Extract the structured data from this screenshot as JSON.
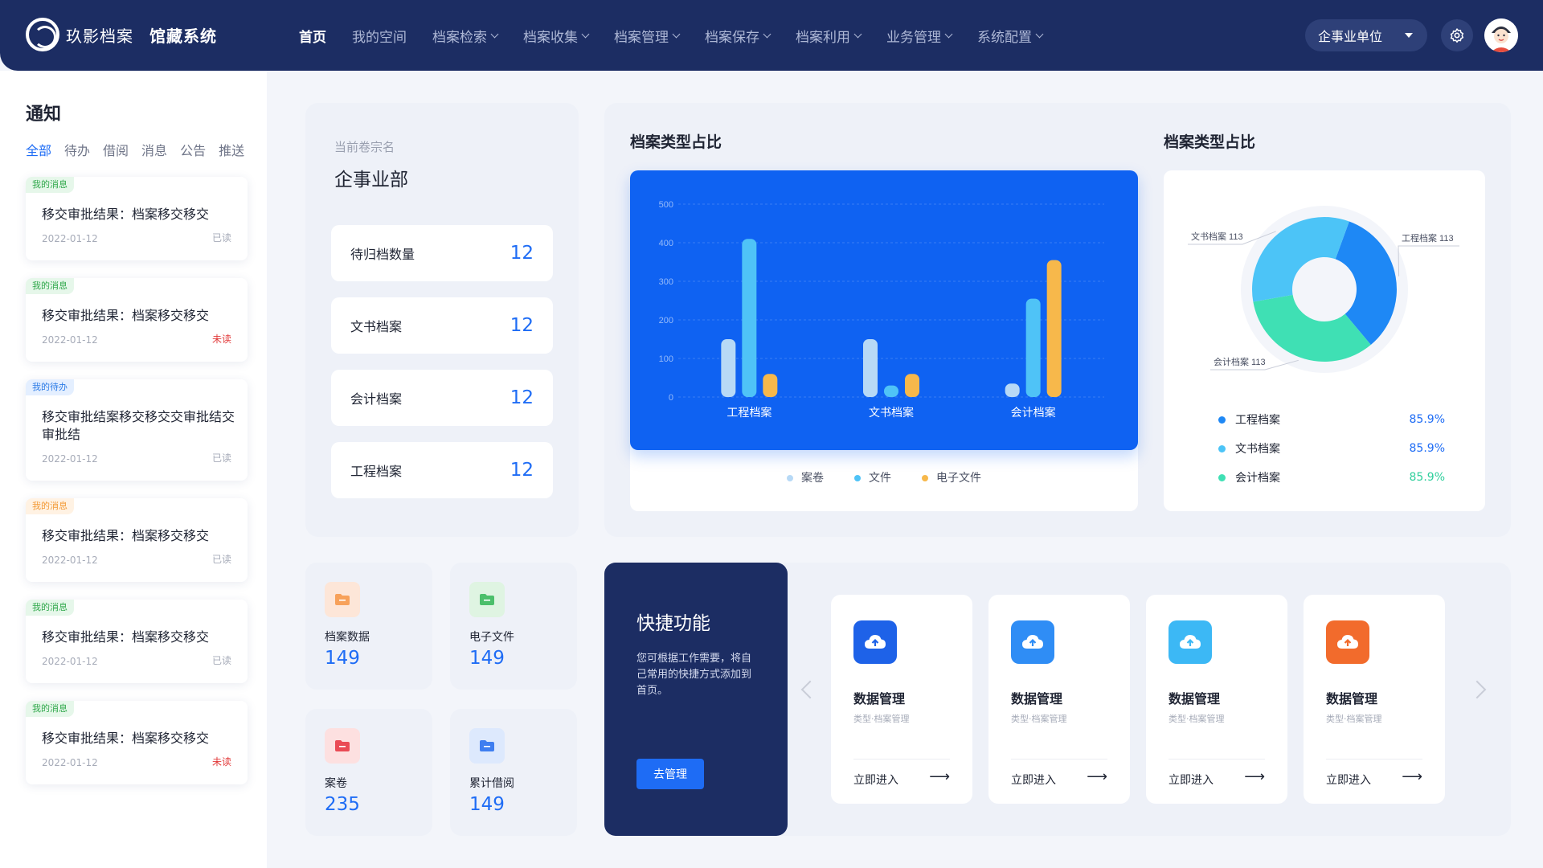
{
  "header": {
    "logo_name": "玖影档案",
    "system_name": "馆藏系统",
    "nav": [
      {
        "label": "首页"
      },
      {
        "label": "我的空间"
      },
      {
        "label": "档案检索"
      },
      {
        "label": "档案收集"
      },
      {
        "label": "档案管理"
      },
      {
        "label": "档案保存"
      },
      {
        "label": "档案利用"
      },
      {
        "label": "业务管理"
      },
      {
        "label": "系统配置"
      }
    ],
    "unit_select": "企事业单位"
  },
  "notice": {
    "title": "通知",
    "tabs": [
      "全部",
      "待办",
      "借阅",
      "消息",
      "公告",
      "推送"
    ],
    "items": [
      {
        "badge": "我的消息",
        "text": "移交审批结果：档案移交移交",
        "date": "2022-01-12",
        "status": "已读"
      },
      {
        "badge": "我的消息",
        "text": "移交审批结果：档案移交移交",
        "date": "2022-01-12",
        "status": "未读"
      },
      {
        "badge": "我的待办",
        "text": "移交审批结案移交移交交审批结交审批结",
        "date": "2022-01-12",
        "status": "已读"
      },
      {
        "badge": "我的消息",
        "text": "移交审批结果：档案移交移交",
        "date": "2022-01-12",
        "status": "已读"
      },
      {
        "badge": "我的消息",
        "text": "移交审批结果：档案移交移交",
        "date": "2022-01-12",
        "status": "已读"
      },
      {
        "badge": "我的消息",
        "text": "移交审批结果：档案移交移交",
        "date": "2022-01-12",
        "status": "未读"
      }
    ]
  },
  "stats": {
    "sub_label": "当前卷宗名",
    "main_label": "企事业部",
    "rows": [
      {
        "label": "待归档数量",
        "value": "12"
      },
      {
        "label": "文书档案",
        "value": "12"
      },
      {
        "label": "会计档案",
        "value": "12"
      },
      {
        "label": "工程档案",
        "value": "12"
      }
    ]
  },
  "tiles": [
    {
      "label": "档案数据",
      "value": "149"
    },
    {
      "label": "电子文件",
      "value": "149"
    },
    {
      "label": "案卷",
      "value": "235"
    },
    {
      "label": "累计借阅",
      "value": "149"
    }
  ],
  "charts": {
    "bar_title": "档案类型占比",
    "pie_title": "档案类型占比"
  },
  "chart_data": [
    {
      "type": "bar",
      "title": "档案类型占比",
      "categories": [
        "工程档案",
        "文书档案",
        "会计档案"
      ],
      "series": [
        {
          "name": "案卷",
          "values": [
            150,
            150,
            35
          ]
        },
        {
          "name": "文件",
          "values": [
            410,
            30,
            255
          ]
        },
        {
          "name": "电子文件",
          "values": [
            60,
            60,
            355
          ]
        }
      ],
      "ylim": [
        0,
        500
      ],
      "yticks": [
        "500",
        "400",
        "300",
        "200",
        "100",
        "0"
      ],
      "legend": "bottom"
    },
    {
      "type": "pie",
      "title": "档案类型占比",
      "slices": [
        {
          "name": "工程档案",
          "value": 113,
          "label": "工程档案 113",
          "percent": "85.9%"
        },
        {
          "name": "文书档案",
          "value": 113,
          "label": "文书档案 113",
          "percent": "85.9%"
        },
        {
          "name": "会计档案",
          "value": 113,
          "label": "会计档案 113",
          "percent": "85.9%"
        }
      ]
    }
  ],
  "colors": {
    "series": [
      "#b7d9f6",
      "#4fc3f7",
      "#f7b84b"
    ],
    "pie": [
      "#1e88f5",
      "#4cc4f7",
      "#3fe0b4"
    ]
  },
  "quick": {
    "title": "快捷功能",
    "desc": "您可根据工作需要，将自己常用的快捷方式添加到首页。",
    "button": "去管理",
    "cards": [
      {
        "title": "数据管理",
        "sub": "类型·档案管理",
        "enter": "立即进入",
        "color": "#1e62e8"
      },
      {
        "title": "数据管理",
        "sub": "类型·档案管理",
        "enter": "立即进入",
        "color": "#2f8df5"
      },
      {
        "title": "数据管理",
        "sub": "类型·档案管理",
        "enter": "立即进入",
        "color": "#3cb8f5"
      },
      {
        "title": "数据管理",
        "sub": "类型·档案管理",
        "enter": "立即进入",
        "color": "#f26b2c"
      }
    ]
  }
}
